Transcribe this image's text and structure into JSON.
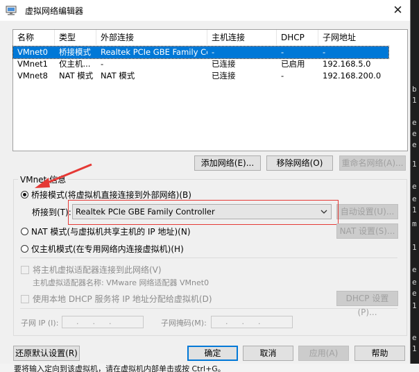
{
  "window": {
    "title": "虚拟网络编辑器",
    "close_glyph": "✕"
  },
  "list": {
    "headers": [
      "名称",
      "类型",
      "外部连接",
      "主机连接",
      "DHCP",
      "子网地址"
    ],
    "rows": [
      [
        "VMnet0",
        "桥接模式",
        "Realtek PCIe GBE Family Co...",
        "-",
        "-",
        "-"
      ],
      [
        "VMnet1",
        "仅主机...",
        "-",
        "已连接",
        "已启用",
        "192.168.5.0"
      ],
      [
        "VMnet8",
        "NAT 模式",
        "NAT 模式",
        "已连接",
        "-",
        "192.168.200.0"
      ]
    ],
    "selected_index": 0,
    "selection_color": "#0078d7"
  },
  "list_buttons": {
    "add": "添加网络(E)...",
    "remove": "移除网络(O)",
    "rename": "重命名网络(A)..."
  },
  "group": {
    "title": "VMnet 信息"
  },
  "bridge": {
    "radio_label": "桥接模式(将虚拟机直接连接到外部网络)(B)",
    "bridge_to_label": "桥接到(T):",
    "adapter_value": "Realtek PCIe GBE Family Controller",
    "auto_button": "自动设置(U)..."
  },
  "nat": {
    "radio_label": "NAT 模式(与虚拟机共享主机的 IP 地址)(N)",
    "settings_button": "NAT 设置(S)..."
  },
  "hostonly": {
    "radio_label": "仅主机模式(在专用网络内连接虚拟机)(H)"
  },
  "host_adapter": {
    "check_label": "将主机虚拟适配器连接到此网络(V)",
    "adapter_name_text": "主机虚拟适配器名称: VMware 网络适配器 VMnet0"
  },
  "dhcp": {
    "check_label": "使用本地 DHCP 服务将 IP 地址分配给虚拟机(D)",
    "settings_button": "DHCP 设置(P)..."
  },
  "subnet": {
    "ip_label": "子网 IP (I):",
    "mask_label": "子网掩码(M):",
    "ip_dots": "...",
    "mask_dots": "..."
  },
  "footer": {
    "restore": "还原默认设置(R)",
    "ok": "确定",
    "cancel": "取消",
    "apply": "应用(A)",
    "help": "帮助"
  },
  "background": {
    "bottom_text": "要将输入定向到该虚拟机，请在虚拟机内部单击或按 Ctrl+G。",
    "right_glyphs": [
      "b",
      "1",
      "e",
      "e",
      "e",
      "1",
      "e",
      "e",
      "1",
      "m",
      "1",
      "e",
      "e",
      "e",
      "1",
      "e",
      "1"
    ]
  },
  "annotation_color": "#e53935"
}
